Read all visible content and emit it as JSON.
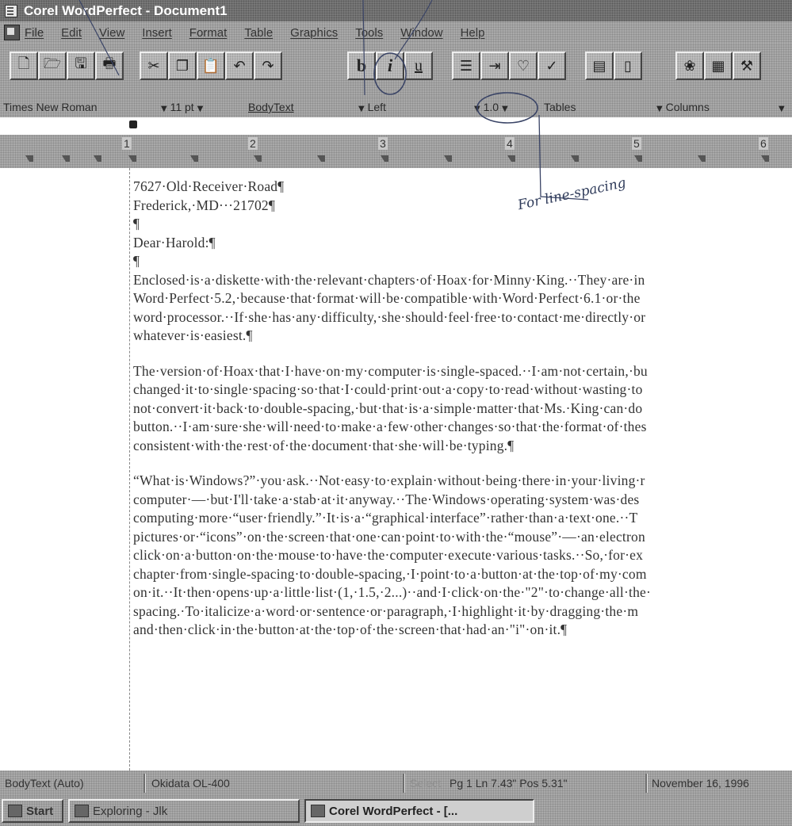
{
  "window": {
    "title": "Corel WordPerfect - Document1"
  },
  "menu": {
    "items": [
      {
        "label": "File"
      },
      {
        "label": "Edit"
      },
      {
        "label": "View"
      },
      {
        "label": "Insert"
      },
      {
        "label": "Format"
      },
      {
        "label": "Table"
      },
      {
        "label": "Graphics"
      },
      {
        "label": "Tools"
      },
      {
        "label": "Window"
      },
      {
        "label": "Help"
      }
    ]
  },
  "toolbar": {
    "buttons": [
      {
        "icon": "new-document-icon",
        "glyph": "🗋"
      },
      {
        "icon": "open-folder-icon",
        "glyph": "🗁"
      },
      {
        "icon": "save-icon",
        "glyph": "🖫"
      },
      {
        "icon": "print-icon",
        "glyph": "🖶"
      },
      {
        "icon": "cut-icon",
        "glyph": "✂"
      },
      {
        "icon": "copy-icon",
        "glyph": "❐"
      },
      {
        "icon": "paste-icon",
        "glyph": "📋"
      },
      {
        "icon": "undo-icon",
        "glyph": "↶"
      },
      {
        "icon": "redo-icon",
        "glyph": "↷"
      },
      {
        "icon": "bold-icon",
        "glyph": "b"
      },
      {
        "icon": "italic-icon",
        "glyph": "i"
      },
      {
        "icon": "underline-icon",
        "glyph": "u"
      },
      {
        "icon": "bullets-icon",
        "glyph": "☰"
      },
      {
        "icon": "indent-icon",
        "glyph": "⇥"
      },
      {
        "icon": "quickformat-icon",
        "glyph": "♡"
      },
      {
        "icon": "spell-check-icon",
        "glyph": "✓"
      },
      {
        "icon": "page-view-icon",
        "glyph": "▤"
      },
      {
        "icon": "zoom-icon",
        "glyph": "▯"
      },
      {
        "icon": "graphics-icon",
        "glyph": "❀"
      },
      {
        "icon": "chart-icon",
        "glyph": "▦"
      },
      {
        "icon": "tools-icon",
        "glyph": "⚒"
      }
    ]
  },
  "property_bar": {
    "font": "Times New Roman",
    "size": "11 pt",
    "style": "BodyText",
    "justification": "Left",
    "line_spacing": "1.0",
    "tables": "Tables",
    "columns": "Columns"
  },
  "ruler": {
    "marks": [
      "1",
      "2",
      "3",
      "4",
      "5",
      "6"
    ]
  },
  "document": {
    "lines": [
      "7627·Old·Receiver·Road¶",
      "Frederick,·MD···21702¶",
      "¶",
      "Dear·Harold:¶",
      "¶",
      "Enclosed·is·a·diskette·with·the·relevant·chapters·of·Hoax·for·Minny·King.··They·are·in",
      "Word·Perfect·5.2,·because·that·format·will·be·compatible·with·Word·Perfect·6.1·or·the",
      "word·processor.··If·she·has·any·difficulty,·she·should·feel·free·to·contact·me·directly·or",
      "whatever·is·easiest.¶",
      "",
      "The·version·of·Hoax·that·I·have·on·my·computer·is·single-spaced.··I·am·not·certain,·bu",
      "changed·it·to·single·spacing·so·that·I·could·print·out·a·copy·to·read·without·wasting·to",
      "not·convert·it·back·to·double-spacing,·but·that·is·a·simple·matter·that·Ms.·King·can·do",
      "button.··I·am·sure·she·will·need·to·make·a·few·other·changes·so·that·the·format·of·thes",
      "consistent·with·the·rest·of·the·document·that·she·will·be·typing.¶",
      "",
      "“What·is·Windows?”·you·ask.··Not·easy·to·explain·without·being·there·in·your·living·r",
      "computer·—·but·I'll·take·a·stab·at·it·anyway.··The·Windows·operating·system·was·des",
      "computing·more·“user·friendly.”·It·is·a·“graphical·interface”·rather·than·a·text·one.··T",
      "pictures·or·“icons”·on·the·screen·that·one·can·point·to·with·the·“mouse”·—·an·electron",
      "click·on·a·button·on·the·mouse·to·have·the·computer·execute·various·tasks.··So,·for·ex",
      "chapter·from·single-spacing·to·double-spacing,·I·point·to·a·button·at·the·top·of·my·com",
      "on·it.··It·then·opens·up·a·little·list·(1,·1.5,·2...)··and·I·click·on·the·\"2\"·to·change·all·the·",
      "spacing.·To·italicize·a·word·or·sentence·or·paragraph,·I·highlight·it·by·dragging·the·m",
      "and·then·click·in·the·button·at·the·top·of·the·screen·that·had·an·\"i\"·on·it.¶"
    ]
  },
  "annotation": {
    "text": "For line-spacing"
  },
  "status_bar": {
    "style": "BodyText (Auto)",
    "printer": "Okidata OL-400",
    "select": "Select",
    "position": "Pg 1 Ln 7.43\" Pos 5.31\"",
    "date": "November 16, 1996"
  },
  "taskbar": {
    "start": "Start",
    "tasks": [
      {
        "label": "Exploring - Jlk",
        "active": false
      },
      {
        "label": "Corel WordPerfect - [...",
        "active": true
      }
    ]
  }
}
